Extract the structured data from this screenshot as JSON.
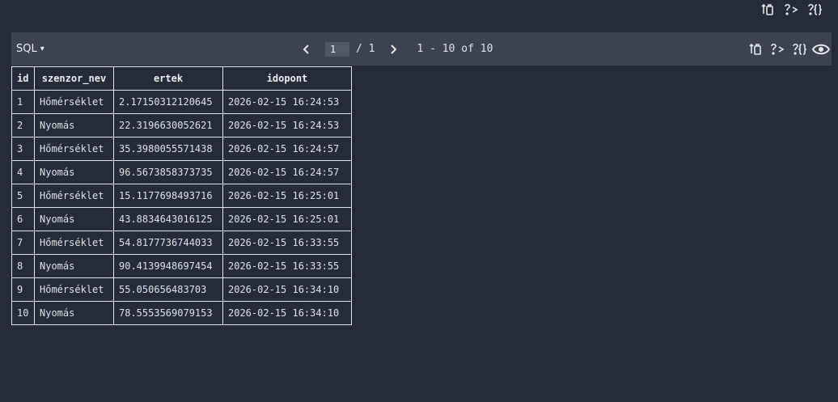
{
  "top_actions": [
    {
      "name": "copy-icon"
    },
    {
      "name": "code-icon"
    },
    {
      "name": "braces-icon"
    }
  ],
  "toolbar": {
    "sql_label": "SQL",
    "sql_caret": "▾",
    "current_page": "1",
    "page_total": "/ 1",
    "range_text": "1 - 10 of 10",
    "actions": [
      {
        "name": "copy-icon"
      },
      {
        "name": "code-icon"
      },
      {
        "name": "braces-icon"
      },
      {
        "name": "eye-icon"
      }
    ]
  },
  "table": {
    "columns": [
      "id",
      "szenzor_nev",
      "ertek",
      "idopont"
    ],
    "rows": [
      [
        "1",
        "Hőmérséklet",
        "2.17150312120645",
        "2026-02-15 16:24:53"
      ],
      [
        "2",
        "Nyomás",
        "22.3196630052621",
        "2026-02-15 16:24:53"
      ],
      [
        "3",
        "Hőmérséklet",
        "35.3980055571438",
        "2026-02-15 16:24:57"
      ],
      [
        "4",
        "Nyomás",
        "96.5673858373735",
        "2026-02-15 16:24:57"
      ],
      [
        "5",
        "Hőmérséklet",
        "15.1177698493716",
        "2026-02-15 16:25:01"
      ],
      [
        "6",
        "Nyomás",
        "43.8834643016125",
        "2026-02-15 16:25:01"
      ],
      [
        "7",
        "Hőmérséklet",
        "54.8177736744033",
        "2026-02-15 16:33:55"
      ],
      [
        "8",
        "Nyomás",
        "90.4139948697454",
        "2026-02-15 16:33:55"
      ],
      [
        "9",
        "Hőmérséklet",
        "55.050656483703",
        "2026-02-15 16:34:10"
      ],
      [
        "10",
        "Nyomás",
        "78.5553569079153",
        "2026-02-15 16:34:10"
      ]
    ]
  }
}
